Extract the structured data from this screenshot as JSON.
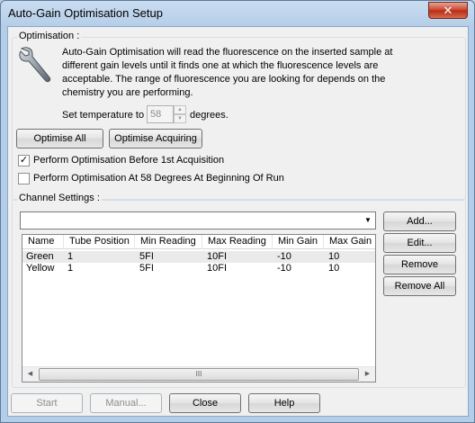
{
  "window": {
    "title": "Auto-Gain Optimisation Setup",
    "close_glyph": "✕"
  },
  "optimisation": {
    "group_label": "Optimisation :",
    "description_lines": [
      "Auto-Gain Optimisation will read the fluorescence on the inserted sample at",
      "different gain levels until it finds one at which the fluorescence levels are",
      "acceptable. The range of fluorescence you are looking for depends on the",
      "chemistry you are performing."
    ],
    "temp_prefix": "Set temperature to",
    "temp_value": "58",
    "temp_suffix": "degrees.",
    "optimise_all_label": "Optimise All",
    "optimise_acquiring_label": "Optimise Acquiring",
    "checkbox1": {
      "label": "Perform Optimisation Before 1st Acquisition",
      "checked": true
    },
    "checkbox2": {
      "label": "Perform Optimisation At 58 Degrees At Beginning Of Run",
      "checked": false
    }
  },
  "channels": {
    "group_label": "Channel Settings :",
    "combo_value": "",
    "columns": [
      "Name",
      "Tube Position",
      "Min Reading",
      "Max Reading",
      "Min Gain",
      "Max Gain"
    ],
    "rows": [
      [
        "Green",
        "1",
        "5FI",
        "10FI",
        "-10",
        "10"
      ],
      [
        "Yellow",
        "1",
        "5FI",
        "10FI",
        "-10",
        "10"
      ]
    ],
    "add_label": "Add...",
    "edit_label": "Edit...",
    "remove_label": "Remove",
    "remove_all_label": "Remove All",
    "scroll_grip": "III"
  },
  "footer": {
    "start_label": "Start",
    "manual_label": "Manual...",
    "close_label": "Close",
    "help_label": "Help"
  }
}
